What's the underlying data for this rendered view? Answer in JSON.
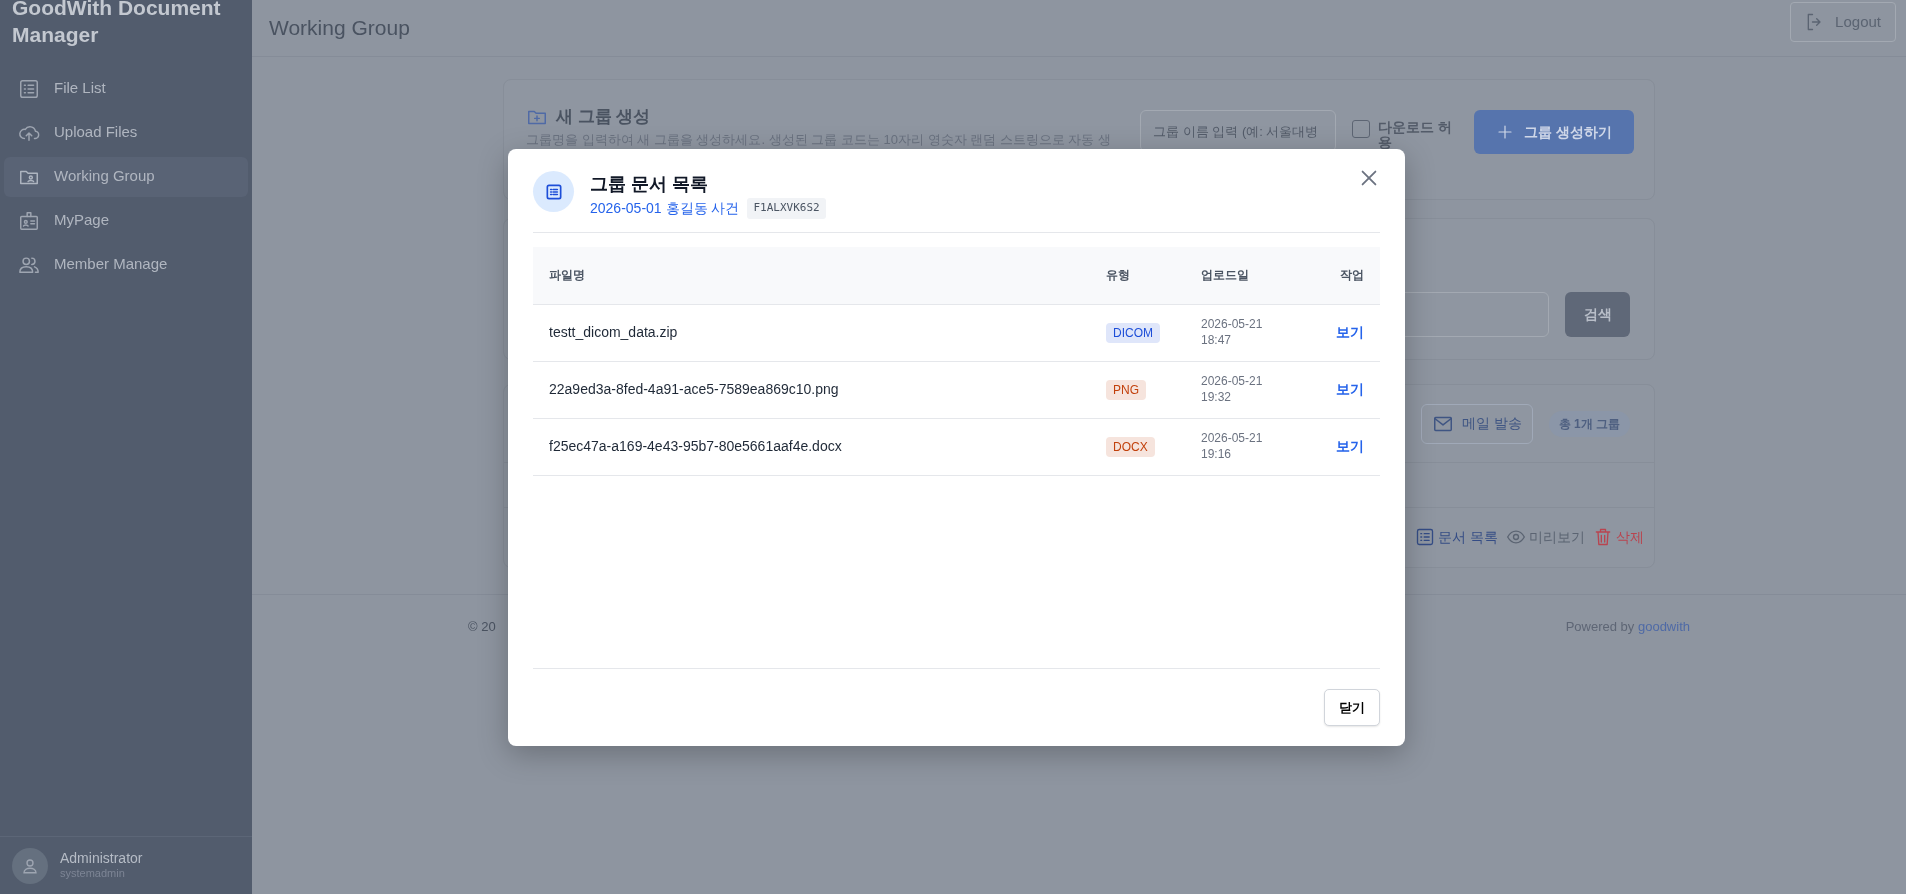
{
  "sidebar": {
    "brand": "GoodWith Document Manager",
    "items": [
      {
        "label": "File List",
        "selected": false
      },
      {
        "label": "Upload Files",
        "selected": false
      },
      {
        "label": "Working Group",
        "selected": true
      },
      {
        "label": "MyPage",
        "selected": false
      },
      {
        "label": "Member Manage",
        "selected": false
      }
    ],
    "user": {
      "name": "Administrator",
      "id": "systemadmin"
    }
  },
  "header": {
    "title": "Working Group",
    "logout": "Logout"
  },
  "create_card": {
    "title": "새 그룹 생성",
    "description": "그룹명을 입력하여 새 그룹을 생성하세요. 생성된 그룹 코드는 10자리 영숫자 랜덤 스트링으로 자동 생",
    "placeholder": "그룹 이름 입력 (예: 서울대병",
    "download_label": "다운로드 허용",
    "download_checked": false,
    "create_button": "그룹 생성하기"
  },
  "search_card": {
    "button": "검색"
  },
  "group_card": {
    "mail_button": "메일 발송",
    "count": "총 1개 그룹",
    "actions": [
      {
        "label": "문서 목록",
        "kind": "list"
      },
      {
        "label": "미리보기",
        "kind": "preview"
      },
      {
        "label": "삭제",
        "kind": "delete"
      }
    ]
  },
  "footer": {
    "copyright": "© 20",
    "powered_prefix": "Powered by",
    "powered_link": "goodwith"
  },
  "modal": {
    "title": "그룹 문서 목록",
    "group_name": "2026-05-01 홍길동 사건",
    "group_code": "F1ALXVK6S2",
    "columns": [
      "파일명",
      "유형",
      "업로드일",
      "작업"
    ],
    "rows": [
      {
        "file": "testt_dicom_data.zip",
        "type": "DICOM",
        "color": "#1d4ed8",
        "date": "2026-05-21",
        "time": "18:47",
        "action": "보기"
      },
      {
        "file": "22a9ed3a-8fed-4a91-ace5-7589ea869c10.png",
        "type": "PNG",
        "color": "#c2410c",
        "date": "2026-05-21",
        "time": "19:32",
        "action": "보기"
      },
      {
        "file": "f25ec47a-a169-4e43-95b7-80e5661aaf4e.docx",
        "type": "DOCX",
        "color": "#c2410c",
        "date": "2026-05-21",
        "time": "19:16",
        "action": "보기"
      }
    ],
    "close_button": "닫기"
  }
}
